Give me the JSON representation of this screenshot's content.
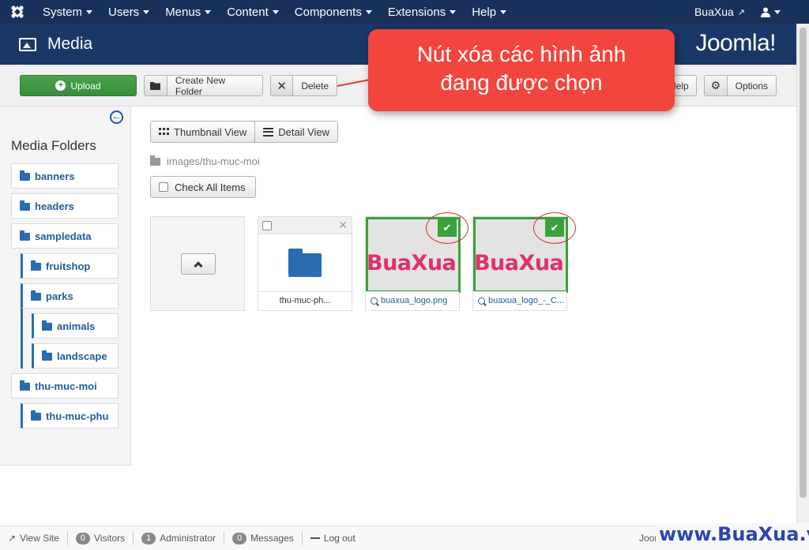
{
  "navbar": {
    "menu": [
      "System",
      "Users",
      "Menus",
      "Content",
      "Components",
      "Extensions",
      "Help"
    ],
    "site_name": "BuaXua"
  },
  "header": {
    "title": "Media",
    "brand": "Joomla!"
  },
  "toolbar": {
    "upload": "Upload",
    "new_folder": "Create New Folder",
    "delete": "Delete",
    "help": "Help",
    "options": "Options"
  },
  "sidebar": {
    "title": "Media Folders",
    "folders": [
      {
        "label": "banners",
        "level": 0
      },
      {
        "label": "headers",
        "level": 0
      },
      {
        "label": "sampledata",
        "level": 0
      },
      {
        "label": "fruitshop",
        "level": 1
      },
      {
        "label": "parks",
        "level": 1
      },
      {
        "label": "animals",
        "level": 2
      },
      {
        "label": "landscape",
        "level": 2
      },
      {
        "label": "thu-muc-moi",
        "level": 0
      },
      {
        "label": "thu-muc-phu",
        "level": 1
      }
    ]
  },
  "main": {
    "thumbnail_view": "Thumbnail View",
    "detail_view": "Detail View",
    "path": "images/thu-muc-moi",
    "check_all": "Check All Items",
    "items": [
      {
        "type": "folder",
        "name": "thu-muc-ph...",
        "checked": false
      },
      {
        "type": "image",
        "name": "buaxua_logo.png",
        "checked": true,
        "image_text": "BuaXua"
      },
      {
        "type": "image",
        "name": "buaxua_logo_-_C...",
        "checked": true,
        "image_text": "BuaXua"
      }
    ]
  },
  "callout": {
    "line1": "Nút xóa các hình ảnh",
    "line2": "đang được chọn"
  },
  "statusbar": {
    "view_site": "View Site",
    "visitors_count": "0",
    "visitors": "Visitors",
    "admin_count": "1",
    "admin": "Administrator",
    "messages_count": "0",
    "messages": "Messages",
    "logout": "Log out",
    "joomla_partial": "Joom"
  },
  "watermark": "www.BuaXua.vn",
  "colors": {
    "navbar": "#17315a",
    "header": "#1a3867",
    "upload_green": "#3d943f",
    "folder_blue": "#2a6cb0",
    "callout_red": "#f2453d",
    "selected_green": "#3aa13c"
  }
}
